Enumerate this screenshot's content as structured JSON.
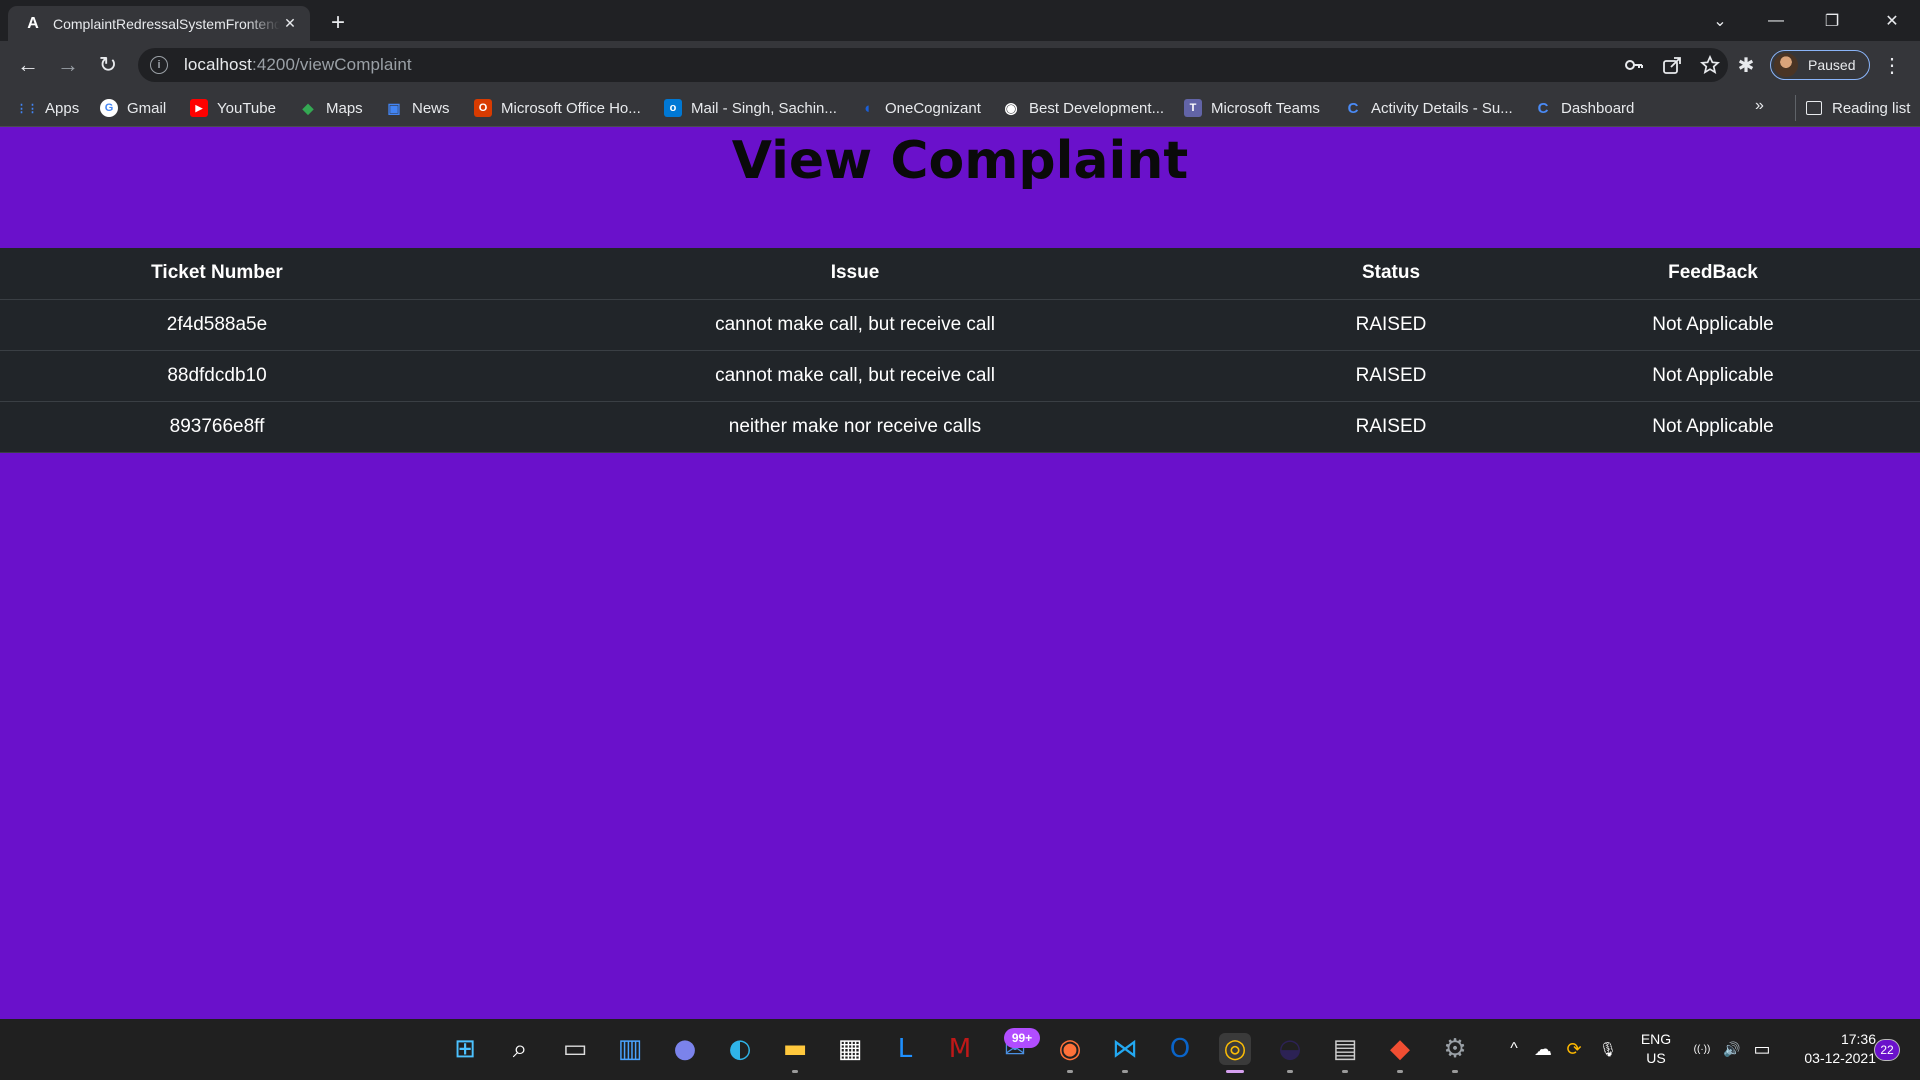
{
  "browser": {
    "tab": {
      "title": "ComplaintRedressalSystemFrontend",
      "favicon": "angular-icon",
      "favicon_glyph": "A",
      "close_glyph": "✕"
    },
    "new_tab_glyph": "+",
    "window_controls": {
      "chevron": "⌄",
      "minimize": "—",
      "restore": "❐",
      "close": "✕"
    },
    "nav": {
      "back": "←",
      "forward": "→",
      "reload": "↻"
    },
    "address": {
      "host": "localhost",
      "path": ":4200/viewComplaint",
      "info_glyph": "i"
    },
    "omni_actions": [
      "key-icon",
      "share-icon",
      "star-icon"
    ],
    "profile": {
      "label": "Paused"
    },
    "menu_glyph": "⋮",
    "extensions_glyph": "✱"
  },
  "bookmarks": {
    "items": [
      {
        "label": "Apps",
        "icon": "apps-grid-icon",
        "glyph": "⋮⋮",
        "color": "#4285f4"
      },
      {
        "label": "Gmail",
        "icon": "google-icon",
        "glyph": "G",
        "color": "#ffffff"
      },
      {
        "label": "YouTube",
        "icon": "youtube-icon",
        "glyph": "▶",
        "color": "#ff0000"
      },
      {
        "label": "Maps",
        "icon": "maps-icon",
        "glyph": "◆",
        "color": "#34a853"
      },
      {
        "label": "News",
        "icon": "news-icon",
        "glyph": "▣",
        "color": "#4285f4"
      },
      {
        "label": "Microsoft Office Ho...",
        "icon": "office-icon",
        "glyph": "O",
        "color": "#d83b01"
      },
      {
        "label": "Mail - Singh, Sachin...",
        "icon": "outlook-icon",
        "glyph": "o",
        "color": "#0078d4"
      },
      {
        "label": "OneCognizant",
        "icon": "cognizant-icon",
        "glyph": "◖",
        "color": "#0033a1"
      },
      {
        "label": "Best Development...",
        "icon": "tool-icon",
        "glyph": "◉",
        "color": "#ffffff"
      },
      {
        "label": "Microsoft Teams",
        "icon": "teams-icon",
        "glyph": "T",
        "color": "#6264a7"
      },
      {
        "label": "Activity Details - Su...",
        "icon": "c-logo-icon",
        "glyph": "C",
        "color": "#1a73e8"
      },
      {
        "label": "Dashboard",
        "icon": "c-logo-icon",
        "glyph": "C",
        "color": "#1a73e8"
      }
    ],
    "more_glyph": "»",
    "reading_list": "Reading list"
  },
  "page": {
    "title": "View Complaint",
    "table": {
      "headers": [
        "Ticket Number",
        "Issue",
        "Status",
        "FeedBack"
      ],
      "rows": [
        [
          "2f4d588a5e",
          "cannot make call, but receive call",
          "RAISED",
          "Not Applicable"
        ],
        [
          "88dfdcdb10",
          "cannot make call, but receive call",
          "RAISED",
          "Not Applicable"
        ],
        [
          "893766e8ff",
          "neither make nor receive calls",
          "RAISED",
          "Not Applicable"
        ]
      ]
    }
  },
  "taskbar": {
    "apps": [
      {
        "name": "start-icon",
        "glyph": "⊞",
        "color": "#4cc2ff"
      },
      {
        "name": "search-icon",
        "glyph": "⌕",
        "color": "#ffffff"
      },
      {
        "name": "task-view-icon",
        "glyph": "▭",
        "color": "#dddddd"
      },
      {
        "name": "widgets-icon",
        "glyph": "▥",
        "color": "#4aa3ff"
      },
      {
        "name": "teams-chat-icon",
        "glyph": "●",
        "color": "#7b83eb"
      },
      {
        "name": "edge-icon",
        "glyph": "◐",
        "color": "#2fb4e9"
      },
      {
        "name": "file-explorer-icon",
        "glyph": "▬",
        "color": "#ffc83d"
      },
      {
        "name": "store-icon",
        "glyph": "▦",
        "color": "#ffffff"
      },
      {
        "name": "l-app-icon",
        "glyph": "L",
        "color": "#1e90ff"
      },
      {
        "name": "mcafee-icon",
        "glyph": "M",
        "color": "#c01818"
      },
      {
        "name": "mail-icon",
        "glyph": "✉",
        "color": "#4a90e2"
      },
      {
        "name": "firefox-icon",
        "glyph": "◉",
        "color": "#ff7139"
      },
      {
        "name": "vscode-icon",
        "glyph": "⋈",
        "color": "#23a9f2"
      },
      {
        "name": "outlook-icon",
        "glyph": "O",
        "color": "#0a64c8"
      },
      {
        "name": "chrome-icon",
        "glyph": "◎",
        "color": "#fbbc05"
      },
      {
        "name": "eclipse-icon",
        "glyph": "◒",
        "color": "#2c2255"
      },
      {
        "name": "mysql-icon",
        "glyph": "▤",
        "color": "#cccccc"
      },
      {
        "name": "git-icon",
        "glyph": "◆",
        "color": "#f14e32"
      },
      {
        "name": "settings-icon",
        "glyph": "⚙",
        "color": "#9aa0a6"
      }
    ],
    "mail_badge": "99+",
    "language": {
      "line1": "ENG",
      "line2": "US"
    },
    "clock": {
      "time": "17:36",
      "date": "03-12-2021"
    },
    "notifications": "22",
    "tray_glyphs": {
      "chevron": "^",
      "cloud": "☁",
      "sync": "⟳",
      "mic": "🎙",
      "wifi": "((·))",
      "volume": "🔊",
      "battery": "▭"
    }
  }
}
